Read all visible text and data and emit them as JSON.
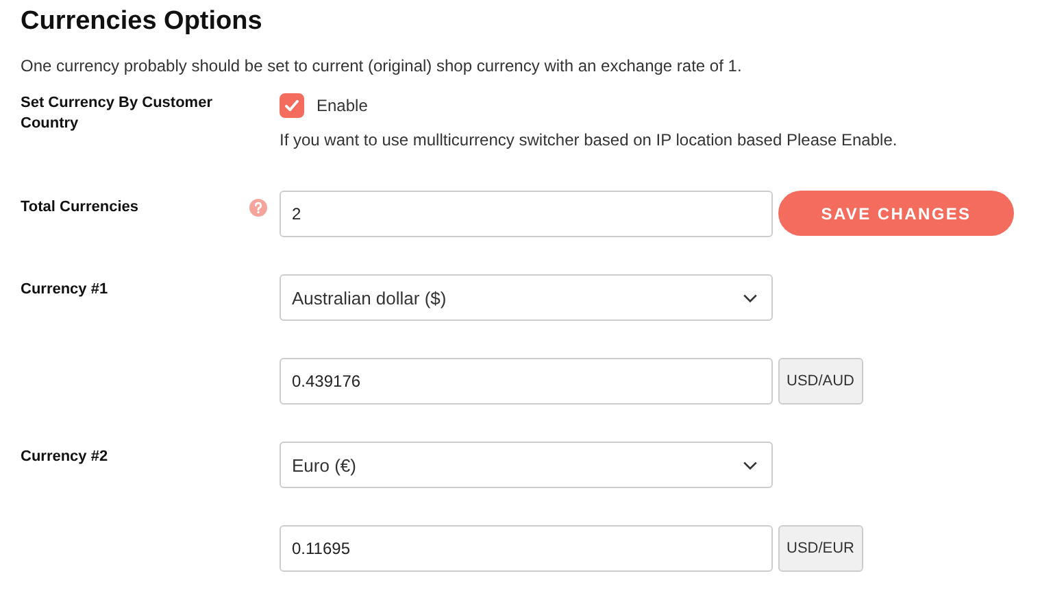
{
  "title": "Currencies Options",
  "description": "One currency probably should be set to current (original) shop currency with an exchange rate of 1.",
  "customer_country": {
    "label": "Set Currency By Customer Country",
    "checkbox_label": "Enable",
    "checked": true,
    "help": "If you want to use mullticurrency switcher based on IP location based Please Enable."
  },
  "total": {
    "label": "Total Currencies",
    "value": "2"
  },
  "save_button": "SAVE CHANGES",
  "currencies": [
    {
      "label": "Currency #1",
      "selected_currency": "Australian dollar ($)",
      "rate": "0.439176",
      "pair": "USD/AUD"
    },
    {
      "label": "Currency #2",
      "selected_currency": "Euro (€)",
      "rate": "0.11695",
      "pair": "USD/EUR"
    }
  ]
}
